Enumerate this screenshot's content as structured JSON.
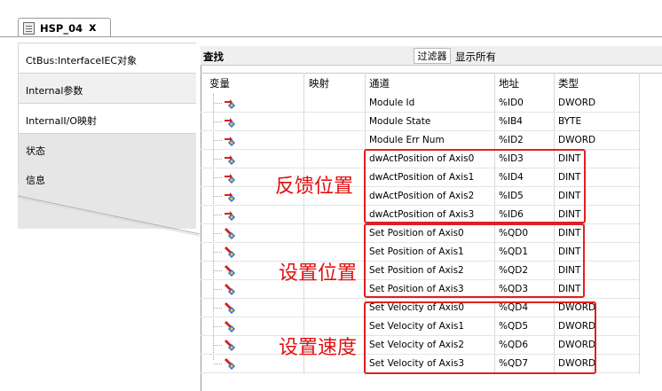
{
  "tab": {
    "title": "HSP_04",
    "close": "x"
  },
  "sidebar": {
    "items": [
      {
        "label": "CtBus:InterfaceIEC对象"
      },
      {
        "label": "Internal参数"
      },
      {
        "label": "InternalI/O映射"
      },
      {
        "label": "状态"
      },
      {
        "label": "信息"
      }
    ]
  },
  "toolbar": {
    "search_label": "查找",
    "filter_button": "过滤器",
    "filter_value": "显示所有"
  },
  "table": {
    "headers": [
      "变量",
      "映射",
      "通道",
      "地址",
      "类型"
    ],
    "rows": [
      {
        "channel": "Module Id",
        "address": "%ID0",
        "type": "DWORD",
        "dir": "in"
      },
      {
        "channel": "Module State",
        "address": "%IB4",
        "type": "BYTE",
        "dir": "in"
      },
      {
        "channel": "Module Err Num",
        "address": "%ID2",
        "type": "DWORD",
        "dir": "in"
      },
      {
        "channel": "dwActPosition of Axis0",
        "address": "%ID3",
        "type": "DINT",
        "dir": "in"
      },
      {
        "channel": "dwActPosition of Axis1",
        "address": "%ID4",
        "type": "DINT",
        "dir": "in"
      },
      {
        "channel": "dwActPosition of Axis2",
        "address": "%ID5",
        "type": "DINT",
        "dir": "in"
      },
      {
        "channel": "dwActPosition of Axis3",
        "address": "%ID6",
        "type": "DINT",
        "dir": "in"
      },
      {
        "channel": "Set Position of Axis0",
        "address": "%QD0",
        "type": "DINT",
        "dir": "out"
      },
      {
        "channel": "Set Position of Axis1",
        "address": "%QD1",
        "type": "DINT",
        "dir": "out"
      },
      {
        "channel": "Set Position of Axis2",
        "address": "%QD2",
        "type": "DINT",
        "dir": "out"
      },
      {
        "channel": "Set Position of Axis3",
        "address": "%QD3",
        "type": "DINT",
        "dir": "out"
      },
      {
        "channel": "Set Velocity of Axis0",
        "address": "%QD4",
        "type": "DWORD",
        "dir": "out"
      },
      {
        "channel": "Set Velocity of Axis1",
        "address": "%QD5",
        "type": "DWORD",
        "dir": "out"
      },
      {
        "channel": "Set Velocity of Axis2",
        "address": "%QD6",
        "type": "DWORD",
        "dir": "out"
      },
      {
        "channel": "Set Velocity of Axis3",
        "address": "%QD7",
        "type": "DWORD",
        "dir": "out"
      }
    ]
  },
  "annotations": {
    "feedback_position": "反馈位置",
    "set_position": "设置位置",
    "set_velocity": "设置速度",
    "color": "#e01010"
  }
}
